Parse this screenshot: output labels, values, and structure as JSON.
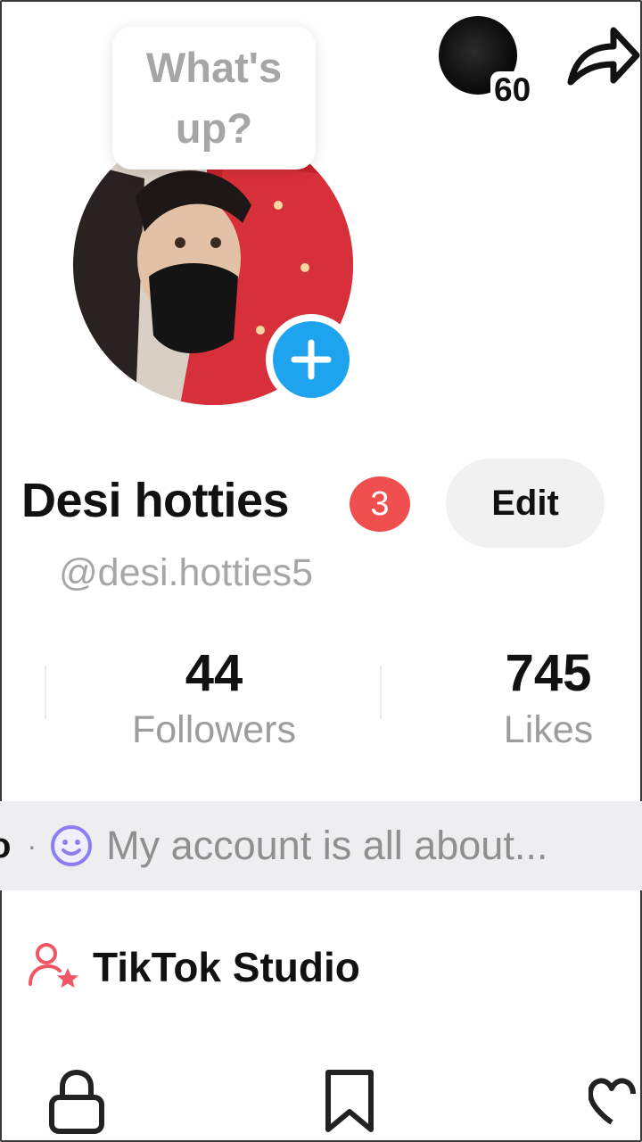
{
  "header": {
    "bubble_text": "What's up?",
    "visitor_count": "60",
    "share_icon": "share-arrow-icon"
  },
  "profile": {
    "display_name": "Desi hotties",
    "notification_badge": "3",
    "edit_label": "Edit",
    "username": "@desi.hotties5"
  },
  "stats": {
    "followers_value": "44",
    "followers_label": "Followers",
    "likes_value": "745",
    "likes_label": "Likes"
  },
  "bio": {
    "leading_fragment": "o",
    "text": "My account is all about..."
  },
  "studio": {
    "label": "TikTok Studio"
  },
  "tabs": [
    "lock-icon",
    "bookmark-icon",
    "heart-icon"
  ],
  "colors": {
    "accent_blue": "#1ea4ee",
    "badge_red": "#f04f4f",
    "studio_icon": "#f25563",
    "smile_icon": "#8b7ff0"
  }
}
